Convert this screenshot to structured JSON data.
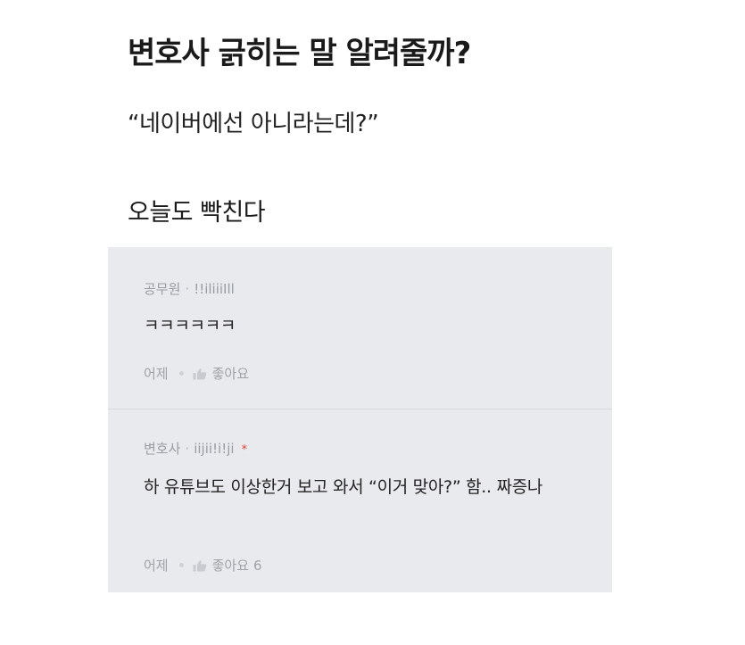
{
  "headline": "변호사 긁히는 말 알려줄까?",
  "quote": "“네이버에선 아니라는데?”",
  "punchline": "오늘도 빡친다",
  "comments": [
    {
      "role": "공무원",
      "separator": "·",
      "nickname": "!!iliiiIll",
      "text": "ㅋㅋㅋㅋㅋㅋ",
      "date": "어제",
      "like_label": "좋아요",
      "like_count": ""
    },
    {
      "role": "변호사",
      "separator": "·",
      "nickname": "iijii!i!ji",
      "badge": "*",
      "text": "하 유튜브도 이상한거 보고 와서 “이거 맞아?” 함.. 짜증나",
      "date": "어제",
      "like_label": "좋아요",
      "like_count": "6"
    }
  ],
  "colors": {
    "panel_bg": "#e9eaed",
    "meta_text": "#9a9ca3",
    "badge": "#e0453d"
  },
  "icons": {
    "like": "thumbs-up-icon"
  }
}
